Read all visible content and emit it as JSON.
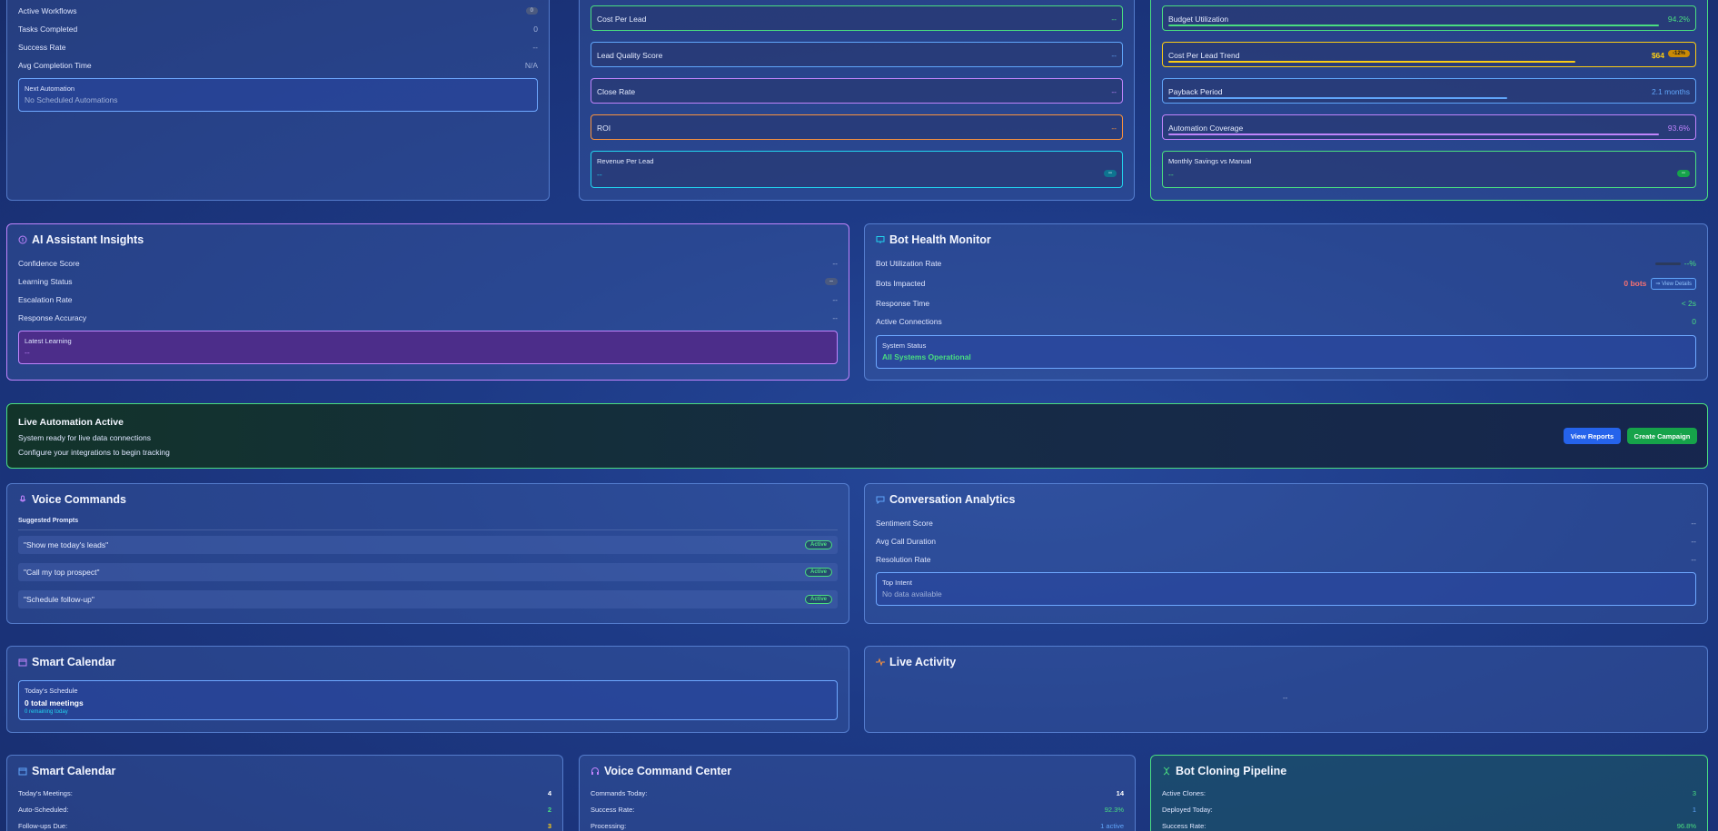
{
  "workflow_card": {
    "rows": [
      {
        "label": "Active Workflows",
        "value": "0"
      },
      {
        "label": "Tasks Completed",
        "value": "0"
      },
      {
        "label": "Success Rate",
        "value": "--"
      },
      {
        "label": "Avg Completion Time",
        "value": "N/A"
      }
    ],
    "next_automation": {
      "label": "Next Automation",
      "value": "No Scheduled Automations"
    }
  },
  "lead_metrics": [
    {
      "label": "Cost Per Lead",
      "value": "--"
    },
    {
      "label": "Lead Quality Score",
      "value": "--"
    },
    {
      "label": "Close Rate",
      "value": "--"
    },
    {
      "label": "ROI",
      "value": "--"
    }
  ],
  "revenue_per_lead": {
    "label": "Revenue Per Lead",
    "value": "--",
    "badge": "--"
  },
  "budget_metrics": {
    "budget_utilization": {
      "label": "Budget Utilization",
      "value": "94.2%",
      "fill": 0.94
    },
    "cost_per_lead_trend": {
      "label": "Cost Per Lead Trend",
      "value": "$64",
      "badge": "-12%",
      "fill": 0.78
    },
    "payback_period": {
      "label": "Payback Period",
      "value": "2.1 months",
      "fill": 0.65
    },
    "automation_coverage": {
      "label": "Automation Coverage",
      "value": "93.6%",
      "fill": 0.94
    },
    "monthly_savings": {
      "label": "Monthly Savings vs Manual",
      "value": "--",
      "badge": "--"
    }
  },
  "ai_insights": {
    "title": "AI Assistant Insights",
    "rows": [
      {
        "label": "Confidence Score",
        "value": "--"
      },
      {
        "label": "Learning Status",
        "value": "--"
      },
      {
        "label": "Escalation Rate",
        "value": "--"
      },
      {
        "label": "Response Accuracy",
        "value": "--"
      }
    ],
    "latest_learning": {
      "label": "Latest Learning",
      "value": "--"
    }
  },
  "bot_health": {
    "title": "Bot Health Monitor",
    "utilization": {
      "label": "Bot Utilization Rate",
      "value": "--%"
    },
    "impacted": {
      "label": "Bots Impacted",
      "value": "0 bots",
      "button": "View Details"
    },
    "response_time": {
      "label": "Response Time",
      "value": "< 2s"
    },
    "active_connections": {
      "label": "Active Connections",
      "value": "0"
    },
    "system_status": {
      "label": "System Status",
      "value": "All Systems Operational"
    }
  },
  "live_banner": {
    "title": "Live Automation Active",
    "line1": "System ready for live data connections",
    "line2": "Configure your integrations to begin tracking",
    "view_reports": "View Reports",
    "create_campaign": "Create Campaign"
  },
  "voice_commands": {
    "title": "Voice Commands",
    "subtitle": "Suggested Prompts",
    "prompts": [
      {
        "text": "\"Show me today's leads\"",
        "status": "Active"
      },
      {
        "text": "\"Call my top prospect\"",
        "status": "Active"
      },
      {
        "text": "\"Schedule follow-up\"",
        "status": "Active"
      }
    ]
  },
  "conversation_analytics": {
    "title": "Conversation Analytics",
    "rows": [
      {
        "label": "Sentiment Score",
        "value": "--"
      },
      {
        "label": "Avg Call Duration",
        "value": "--"
      },
      {
        "label": "Resolution Rate",
        "value": "--"
      }
    ],
    "top_intent": {
      "label": "Top Intent",
      "value": "No data available"
    }
  },
  "smart_calendar_1": {
    "title": "Smart Calendar",
    "schedule_label": "Today's Schedule",
    "total": "0 total meetings",
    "remaining": "0 remaining today"
  },
  "live_activity": {
    "title": "Live Activity",
    "placeholder": "--"
  },
  "smart_calendar_2": {
    "title": "Smart Calendar",
    "rows": [
      {
        "label": "Today's Meetings:",
        "value": "4"
      },
      {
        "label": "Auto-Scheduled:",
        "value": "2"
      },
      {
        "label": "Follow-ups Due:",
        "value": "3"
      }
    ]
  },
  "voice_command_center": {
    "title": "Voice Command Center",
    "rows": [
      {
        "label": "Commands Today:",
        "value": "14"
      },
      {
        "label": "Success Rate:",
        "value": "92.3%"
      },
      {
        "label": "Processing:",
        "value": "1 active"
      }
    ]
  },
  "bot_cloning": {
    "title": "Bot Cloning Pipeline",
    "rows": [
      {
        "label": "Active Clones:",
        "value": "3"
      },
      {
        "label": "Deployed Today:",
        "value": "1"
      },
      {
        "label": "Success Rate:",
        "value": "96.8%"
      }
    ]
  },
  "colors": {
    "green": "#4ade80",
    "blue": "#60a5fa",
    "yellow": "#facc15",
    "purple": "#c084fc",
    "orange": "#fb923c",
    "cyan": "#22d3ee",
    "red": "#f87171"
  }
}
